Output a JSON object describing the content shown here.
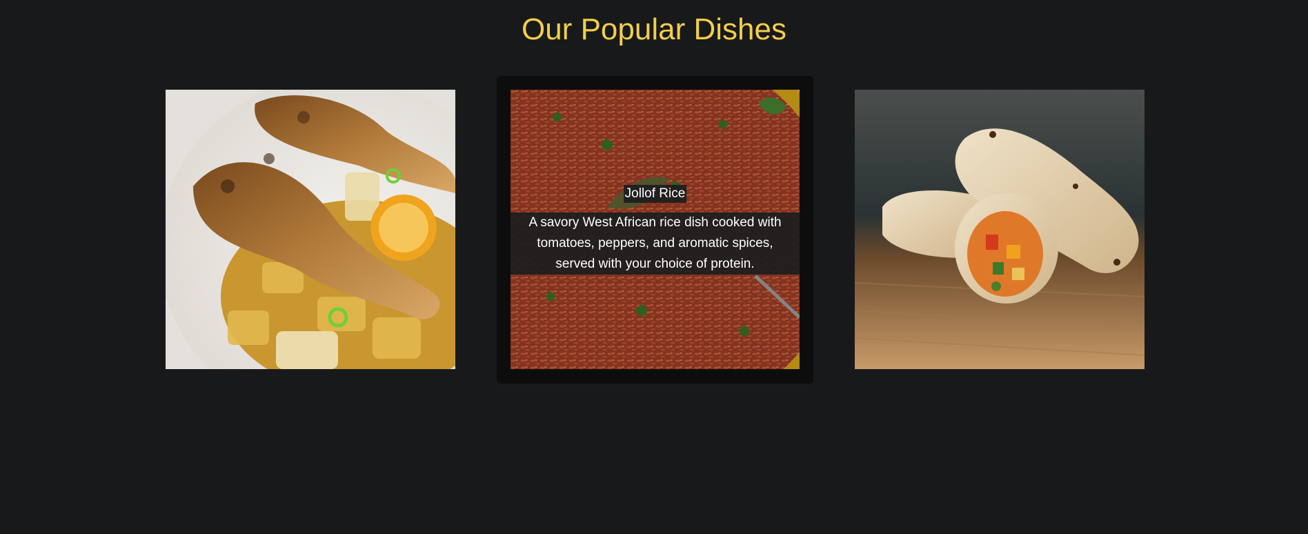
{
  "page": {
    "title": "Our Popular Dishes"
  },
  "dishes": [
    {
      "name": "",
      "description": "",
      "image": "roast-chicken-drumsticks-photo"
    },
    {
      "name": "Jollof Rice",
      "description": "A savory West African rice dish cooked with tomatoes, peppers, and aromatic spices, served with your choice of protein.",
      "image": "jollof-rice-photo",
      "hovered": true
    },
    {
      "name": "",
      "description": "",
      "image": "vegetable-wrap-photo"
    }
  ],
  "colors": {
    "background": "#18191b",
    "title": "#f2cf4a",
    "card_frame": "#0d0d0e"
  }
}
